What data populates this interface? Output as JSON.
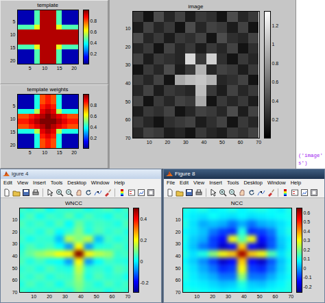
{
  "top_figure": {
    "template": {
      "title": "template",
      "kind": "jet",
      "x_ticks": [
        "5",
        "10",
        "15",
        "20"
      ],
      "y_ticks": [
        "5",
        "10",
        "15",
        "20"
      ],
      "x_range": [
        0.5,
        21.5
      ],
      "y_range": [
        0.5,
        21.5
      ],
      "color_range": [
        0,
        1
      ],
      "colorbar_ticks": [
        "0.2",
        "0.4",
        "0.6",
        "0.8"
      ],
      "cells": [
        [
          0.05,
          0.05,
          0.05,
          0.45,
          0.95,
          0.95,
          0.95,
          0.45,
          0.05,
          0.05,
          0.05
        ],
        [
          0.05,
          0.05,
          0.05,
          0.45,
          0.95,
          0.95,
          0.95,
          0.45,
          0.05,
          0.05,
          0.05
        ],
        [
          0.05,
          0.05,
          0.05,
          0.45,
          0.95,
          0.95,
          0.95,
          0.45,
          0.05,
          0.05,
          0.05
        ],
        [
          0.45,
          0.45,
          0.45,
          0.6,
          0.95,
          0.95,
          0.95,
          0.6,
          0.45,
          0.45,
          0.45
        ],
        [
          0.95,
          0.95,
          0.95,
          0.95,
          0.95,
          0.95,
          0.95,
          0.95,
          0.95,
          0.95,
          0.95
        ],
        [
          0.95,
          0.95,
          0.95,
          0.95,
          0.95,
          0.95,
          0.95,
          0.95,
          0.95,
          0.95,
          0.95
        ],
        [
          0.95,
          0.95,
          0.95,
          0.95,
          0.95,
          0.95,
          0.95,
          0.95,
          0.95,
          0.95,
          0.95
        ],
        [
          0.45,
          0.45,
          0.45,
          0.6,
          0.95,
          0.95,
          0.95,
          0.6,
          0.45,
          0.45,
          0.45
        ],
        [
          0.05,
          0.05,
          0.05,
          0.45,
          0.95,
          0.95,
          0.95,
          0.45,
          0.05,
          0.05,
          0.05
        ],
        [
          0.05,
          0.05,
          0.05,
          0.45,
          0.95,
          0.95,
          0.95,
          0.45,
          0.05,
          0.05,
          0.05
        ],
        [
          0.05,
          0.05,
          0.05,
          0.45,
          0.95,
          0.95,
          0.95,
          0.45,
          0.05,
          0.05,
          0.05
        ]
      ]
    },
    "template_weights": {
      "title": "template weights",
      "kind": "jet",
      "x_ticks": [
        "5",
        "10",
        "15",
        "20"
      ],
      "y_ticks": [
        "5",
        "10",
        "15",
        "20"
      ],
      "x_range": [
        0.5,
        21.5
      ],
      "y_range": [
        0.5,
        21.5
      ],
      "color_range": [
        0,
        1
      ],
      "colorbar_ticks": [
        "0.2",
        "0.4",
        "0.6",
        "0.8"
      ],
      "cells": [
        [
          0.05,
          0.05,
          0.05,
          0.4,
          0.8,
          0.85,
          0.8,
          0.4,
          0.05,
          0.05,
          0.05
        ],
        [
          0.05,
          0.05,
          0.05,
          0.4,
          0.8,
          0.85,
          0.8,
          0.4,
          0.05,
          0.05,
          0.05
        ],
        [
          0.05,
          0.05,
          0.05,
          0.4,
          0.85,
          0.9,
          0.85,
          0.4,
          0.05,
          0.05,
          0.05
        ],
        [
          0.4,
          0.4,
          0.4,
          0.55,
          0.9,
          0.95,
          0.9,
          0.55,
          0.4,
          0.4,
          0.4
        ],
        [
          0.8,
          0.8,
          0.85,
          0.9,
          0.95,
          1.0,
          0.95,
          0.9,
          0.85,
          0.8,
          0.8
        ],
        [
          0.85,
          0.85,
          0.9,
          0.95,
          1.0,
          1.0,
          1.0,
          0.95,
          0.9,
          0.85,
          0.85
        ],
        [
          0.8,
          0.8,
          0.85,
          0.9,
          0.95,
          1.0,
          0.95,
          0.9,
          0.85,
          0.8,
          0.8
        ],
        [
          0.4,
          0.4,
          0.4,
          0.55,
          0.9,
          0.95,
          0.9,
          0.55,
          0.4,
          0.4,
          0.4
        ],
        [
          0.05,
          0.05,
          0.05,
          0.4,
          0.85,
          0.9,
          0.85,
          0.4,
          0.05,
          0.05,
          0.05
        ],
        [
          0.05,
          0.05,
          0.05,
          0.4,
          0.8,
          0.85,
          0.8,
          0.4,
          0.05,
          0.05,
          0.05
        ],
        [
          0.05,
          0.05,
          0.05,
          0.4,
          0.8,
          0.85,
          0.8,
          0.4,
          0.05,
          0.05,
          0.05
        ]
      ]
    },
    "image": {
      "title": "image",
      "kind": "gray",
      "x_ticks": [
        "10",
        "20",
        "30",
        "40",
        "50",
        "60",
        "70"
      ],
      "y_ticks": [
        "10",
        "20",
        "30",
        "40",
        "50",
        "60",
        "70"
      ],
      "x_range": [
        0.5,
        70.5
      ],
      "y_range": [
        0.5,
        70.5
      ],
      "color_range": [
        0,
        1.35
      ],
      "colorbar_ticks": [
        "0.2",
        "0.4",
        "0.6",
        "0.8",
        "1",
        "1.2"
      ],
      "cells": [
        [
          0.3,
          0.1,
          0.4,
          0.2,
          0.35,
          0.15,
          0.3,
          0.25,
          0.1,
          0.4,
          0.2,
          0.3
        ],
        [
          0.15,
          0.35,
          0.2,
          0.3,
          0.1,
          0.4,
          0.2,
          0.35,
          0.3,
          0.15,
          0.35,
          0.1
        ],
        [
          0.4,
          0.2,
          0.3,
          0.15,
          0.3,
          0.25,
          0.35,
          0.1,
          0.4,
          0.25,
          0.2,
          0.35
        ],
        [
          0.2,
          0.3,
          0.1,
          0.35,
          0.2,
          0.3,
          0.15,
          0.3,
          0.2,
          0.35,
          0.1,
          0.25
        ],
        [
          0.35,
          0.15,
          0.3,
          0.25,
          0.2,
          1.15,
          0.3,
          1.1,
          0.25,
          0.1,
          0.3,
          0.2
        ],
        [
          0.1,
          0.3,
          0.2,
          0.4,
          0.15,
          0.3,
          0.95,
          0.2,
          0.35,
          0.3,
          0.15,
          0.3
        ],
        [
          0.3,
          0.2,
          0.35,
          0.1,
          0.9,
          1.0,
          1.05,
          0.95,
          0.2,
          0.25,
          0.35,
          0.1
        ],
        [
          0.2,
          0.35,
          0.15,
          0.3,
          0.25,
          0.2,
          1.0,
          0.3,
          0.15,
          0.35,
          0.2,
          0.3
        ],
        [
          0.35,
          0.1,
          0.3,
          0.2,
          0.35,
          0.3,
          0.9,
          0.1,
          0.3,
          0.2,
          0.3,
          0.15
        ],
        [
          0.15,
          0.3,
          0.25,
          0.35,
          0.1,
          0.2,
          0.35,
          0.3,
          0.2,
          0.4,
          0.15,
          0.35
        ],
        [
          0.3,
          0.2,
          0.1,
          0.25,
          0.3,
          0.35,
          0.15,
          0.25,
          0.35,
          0.1,
          0.3,
          0.2
        ],
        [
          0.2,
          0.35,
          0.3,
          0.15,
          0.2,
          0.1,
          0.3,
          0.2,
          0.15,
          0.3,
          0.25,
          0.35
        ]
      ]
    },
    "command_text": [
      "('image'",
      "s')"
    ]
  },
  "windows": [
    {
      "title": "igure 4",
      "active": false,
      "menus": [
        "Edit",
        "View",
        "Insert",
        "Tools",
        "Desktop",
        "Window",
        "Help"
      ],
      "plot": {
        "title": "WNCC",
        "kind": "jet",
        "x_ticks": [
          "10",
          "20",
          "30",
          "40",
          "50",
          "60",
          "70"
        ],
        "y_ticks": [
          "10",
          "20",
          "30",
          "40",
          "50",
          "60",
          "70"
        ],
        "x_range": [
          0.5,
          70.5
        ],
        "y_range": [
          0.5,
          70.5
        ],
        "color_range": [
          -0.3,
          0.5
        ],
        "colorbar_ticks": [
          "0.4",
          "0.2",
          "0",
          "-0.2"
        ],
        "cells": [
          [
            0.05,
            0.02,
            0.06,
            0.0,
            0.04,
            0.03,
            0.05,
            0.01,
            0.04,
            0.06,
            0.02,
            0.05
          ],
          [
            0.02,
            0.06,
            0.01,
            0.05,
            0.03,
            0.07,
            0.02,
            0.06,
            0.03,
            0.01,
            0.05,
            0.03
          ],
          [
            0.06,
            0.03,
            0.05,
            0.02,
            0.06,
            0.0,
            0.08,
            0.03,
            0.05,
            0.04,
            0.02,
            0.06
          ],
          [
            0.03,
            0.05,
            0.02,
            0.06,
            0.0,
            0.04,
            0.1,
            0.02,
            0.06,
            0.03,
            0.05,
            0.02
          ],
          [
            0.05,
            0.01,
            0.04,
            0.03,
            -0.05,
            0.15,
            0.1,
            0.15,
            -0.05,
            0.05,
            0.02,
            0.04
          ],
          [
            0.02,
            0.06,
            0.03,
            0.05,
            0.0,
            -0.08,
            0.2,
            -0.08,
            0.02,
            0.03,
            0.06,
            0.03
          ],
          [
            0.04,
            0.08,
            0.12,
            0.15,
            0.2,
            0.2,
            0.5,
            0.2,
            0.15,
            0.12,
            0.04,
            0.05
          ],
          [
            0.06,
            0.02,
            0.05,
            0.01,
            0.0,
            -0.08,
            0.2,
            -0.08,
            0.0,
            0.05,
            0.03,
            0.02
          ],
          [
            0.03,
            0.05,
            0.02,
            0.06,
            0.03,
            0.02,
            0.15,
            0.03,
            0.04,
            0.02,
            0.06,
            0.04
          ],
          [
            0.05,
            0.03,
            0.06,
            0.02,
            0.05,
            0.04,
            0.12,
            0.02,
            0.06,
            0.03,
            0.04,
            0.01
          ],
          [
            0.02,
            0.06,
            0.03,
            0.05,
            0.01,
            0.06,
            0.1,
            0.05,
            0.02,
            0.06,
            0.03,
            0.05
          ],
          [
            0.05,
            0.02,
            0.04,
            0.03,
            0.06,
            0.02,
            0.08,
            0.04,
            0.05,
            0.01,
            0.05,
            0.03
          ]
        ]
      }
    },
    {
      "title": "Figure 8",
      "active": true,
      "menus": [
        "File",
        "Edit",
        "View",
        "Insert",
        "Tools",
        "Desktop",
        "Window",
        "Help"
      ],
      "plot": {
        "title": "NCC",
        "kind": "jet",
        "x_ticks": [
          "10",
          "20",
          "30",
          "40",
          "50",
          "60",
          "70"
        ],
        "y_ticks": [
          "10",
          "20",
          "30",
          "40",
          "50",
          "60",
          "70"
        ],
        "x_range": [
          0.5,
          70.5
        ],
        "y_range": [
          0.5,
          70.5
        ],
        "color_range": [
          -0.27,
          0.65
        ],
        "colorbar_ticks": [
          "0.6",
          "0.5",
          "0.4",
          "0.3",
          "0.2",
          "0.1",
          "0",
          "-0.1",
          "-0.2"
        ],
        "cells": [
          [
            0.1,
            0.08,
            0.1,
            0.06,
            0.08,
            0.1,
            0.07,
            0.09,
            0.1,
            0.08,
            0.06,
            0.1
          ],
          [
            0.08,
            0.06,
            0.05,
            0.08,
            0.06,
            0.05,
            0.07,
            0.05,
            0.06,
            0.07,
            0.08,
            0.09
          ],
          [
            0.1,
            0.05,
            0.0,
            0.02,
            0.0,
            -0.05,
            0.0,
            -0.05,
            0.0,
            0.02,
            0.05,
            0.08
          ],
          [
            0.07,
            0.05,
            0.02,
            -0.05,
            -0.1,
            -0.12,
            0.1,
            -0.12,
            -0.1,
            -0.05,
            0.05,
            0.1
          ],
          [
            0.09,
            0.03,
            0.0,
            -0.1,
            -0.15,
            0.3,
            0.15,
            0.3,
            -0.15,
            -0.08,
            0.03,
            0.07
          ],
          [
            0.08,
            0.02,
            -0.05,
            -0.1,
            -0.2,
            -0.15,
            0.35,
            -0.15,
            -0.2,
            -0.08,
            0.02,
            0.08
          ],
          [
            0.1,
            0.05,
            0.1,
            0.2,
            0.3,
            0.35,
            0.62,
            0.35,
            0.3,
            0.15,
            0.05,
            0.1
          ],
          [
            0.07,
            0.03,
            -0.03,
            -0.1,
            -0.2,
            -0.15,
            0.35,
            -0.15,
            -0.2,
            -0.08,
            0.02,
            0.08
          ],
          [
            0.09,
            0.05,
            0.0,
            -0.05,
            -0.12,
            -0.1,
            0.3,
            -0.1,
            -0.12,
            -0.05,
            0.03,
            0.09
          ],
          [
            0.1,
            0.06,
            0.03,
            0.0,
            -0.05,
            -0.05,
            0.2,
            -0.05,
            -0.05,
            0.0,
            0.05,
            0.08
          ],
          [
            0.08,
            0.07,
            0.06,
            0.04,
            0.02,
            0.03,
            0.1,
            0.03,
            0.02,
            0.05,
            0.07,
            0.1
          ],
          [
            0.1,
            0.09,
            0.08,
            0.07,
            0.06,
            0.07,
            0.08,
            0.06,
            0.07,
            0.08,
            0.09,
            0.1
          ]
        ]
      }
    }
  ]
}
